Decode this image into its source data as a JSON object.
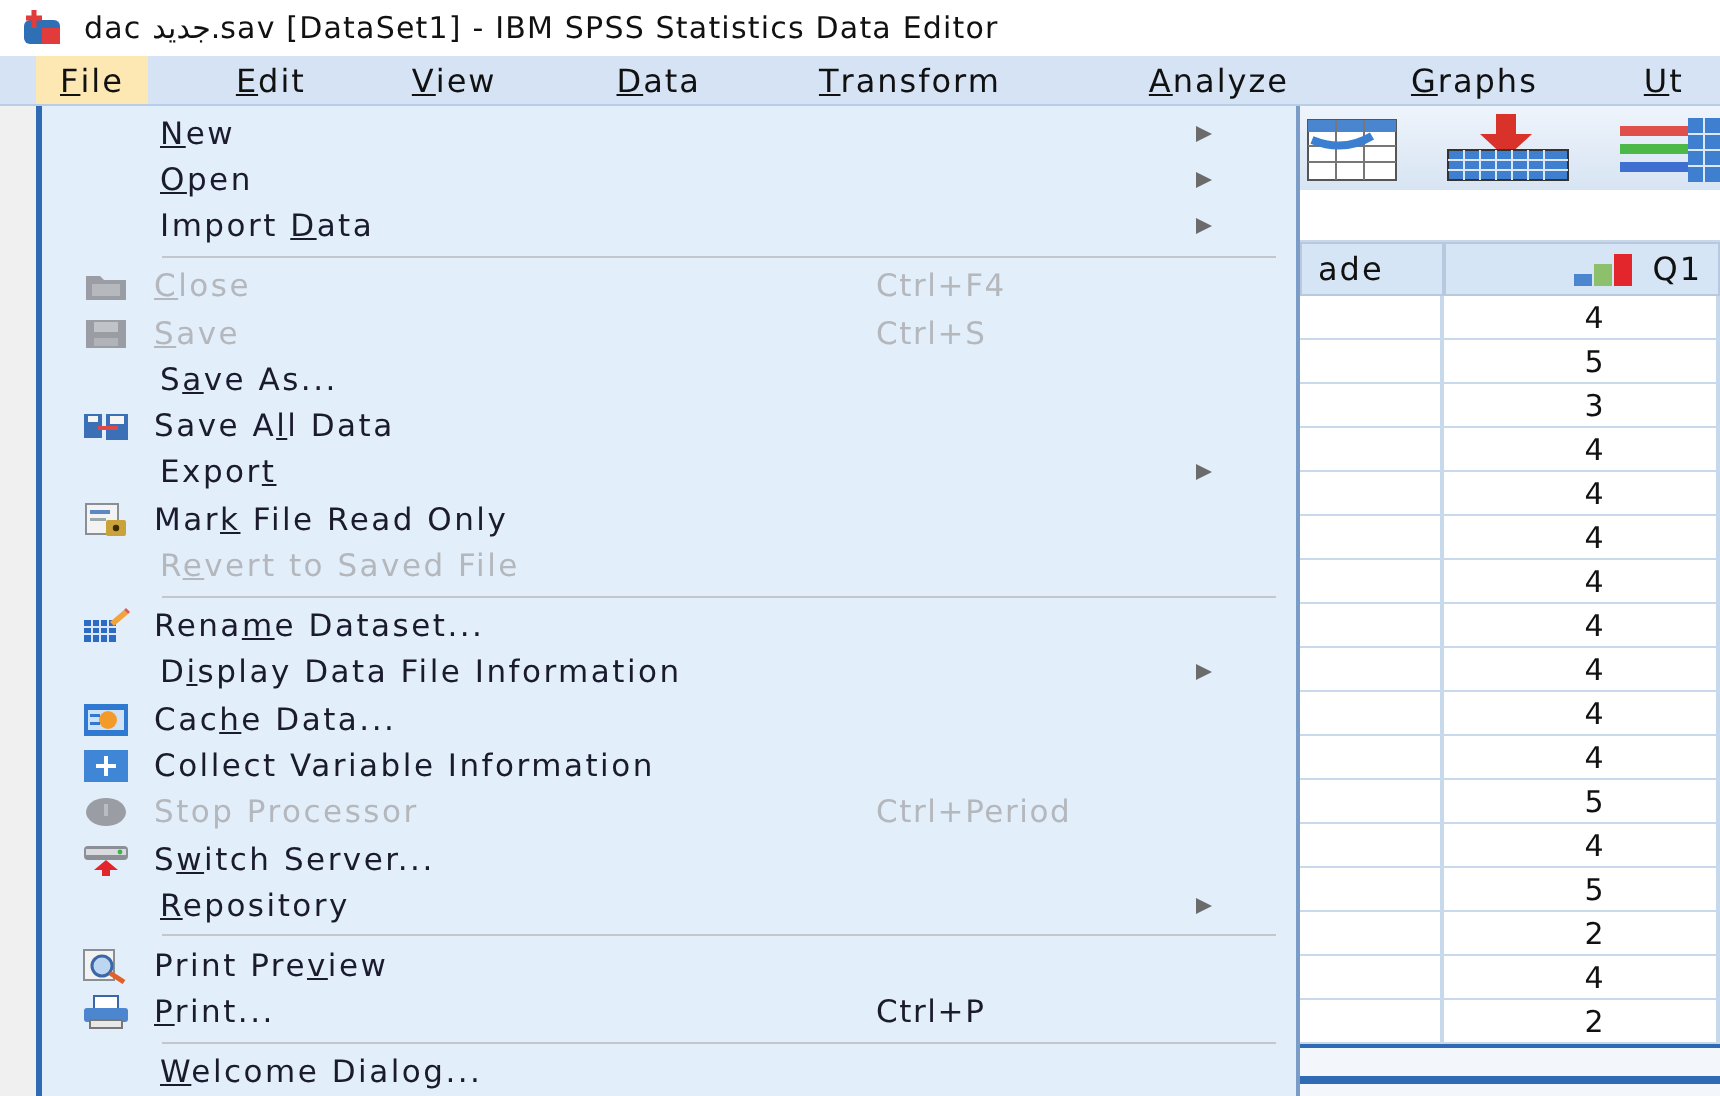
{
  "window": {
    "title": "dac جديد.sav [DataSet1] - IBM SPSS Statistics Data Editor"
  },
  "menu_bar": [
    {
      "access_key": "F",
      "label_after": "ile",
      "selected": true
    },
    {
      "access_key": "E",
      "label_after": "dit",
      "selected": false
    },
    {
      "access_key": "V",
      "label_after": "iew",
      "selected": false
    },
    {
      "access_key": "D",
      "label_after": "ata",
      "selected": false
    },
    {
      "access_key": "T",
      "label_after": "ransform",
      "selected": false
    },
    {
      "access_key": "A",
      "label_after": "nalyze",
      "selected": false
    },
    {
      "access_key": "G",
      "label_after": "raphs",
      "selected": false
    },
    {
      "access_key": "U",
      "label_after": "t",
      "selected": false
    }
  ],
  "file_menu": {
    "items": [
      {
        "kind": "submenu",
        "access_key": "N",
        "label_after": "ew",
        "disabled": false
      },
      {
        "kind": "submenu",
        "access_key": "O",
        "label_after": "pen",
        "disabled": false
      },
      {
        "kind": "submenu",
        "label_before": "Import ",
        "access_key": "D",
        "label_after": "ata",
        "disabled": false
      },
      {
        "kind": "separator"
      },
      {
        "kind": "command",
        "access_key": "C",
        "label_after": "lose",
        "shortcut": "Ctrl+F4",
        "disabled": true
      },
      {
        "kind": "command",
        "access_key": "S",
        "label_after": "ave",
        "shortcut": "Ctrl+S",
        "disabled": true
      },
      {
        "kind": "command",
        "label_before": "S",
        "access_key": "a",
        "label_after": "ve As...",
        "disabled": false
      },
      {
        "kind": "command",
        "label_before": "Save A",
        "access_key": "l",
        "label_after": "l Data",
        "disabled": false
      },
      {
        "kind": "submenu",
        "label_before": "Expor",
        "access_key": "t",
        "disabled": false
      },
      {
        "kind": "command",
        "label_before": "Mar",
        "access_key": "k",
        "label_after": " File Read Only",
        "disabled": false
      },
      {
        "kind": "command",
        "label_before": "R",
        "access_key": "e",
        "label_after": "vert to Saved File",
        "disabled": true
      },
      {
        "kind": "separator"
      },
      {
        "kind": "command",
        "label_before": "Rena",
        "access_key": "m",
        "label_after": "e Dataset...",
        "disabled": false
      },
      {
        "kind": "submenu",
        "label_before": "D",
        "access_key": "i",
        "label_after": "splay Data File Information",
        "disabled": false
      },
      {
        "kind": "command",
        "label_before": "Cac",
        "access_key": "h",
        "label_after": "e Data...",
        "disabled": false
      },
      {
        "kind": "command",
        "label_before": "Collect Variable Information",
        "disabled": false
      },
      {
        "kind": "command",
        "label_before": "Stop Processor",
        "shortcut": "Ctrl+Period",
        "disabled": true
      },
      {
        "kind": "command",
        "label_before": "S",
        "access_key": "w",
        "label_after": "itch Server...",
        "disabled": false
      },
      {
        "kind": "submenu",
        "access_key": "R",
        "label_after": "epository",
        "disabled": false
      },
      {
        "kind": "separator"
      },
      {
        "kind": "command",
        "label_before": "Print Pre",
        "access_key": "v",
        "label_after": "iew",
        "disabled": false
      },
      {
        "kind": "command",
        "access_key": "P",
        "label_after": "rint...",
        "shortcut": "Ctrl+P",
        "disabled": false
      },
      {
        "kind": "separator"
      },
      {
        "kind": "command",
        "access_key": "W",
        "label_after": "elcome Dialog...",
        "disabled": false
      }
    ]
  },
  "data_grid": {
    "columns": [
      {
        "label": "ade"
      },
      {
        "label": "Q1",
        "cells": [
          "4",
          "5",
          "3",
          "4",
          "4",
          "4",
          "4",
          "4",
          "4",
          "4",
          "4",
          "5",
          "4",
          "5",
          "2",
          "4",
          "2"
        ]
      }
    ]
  }
}
